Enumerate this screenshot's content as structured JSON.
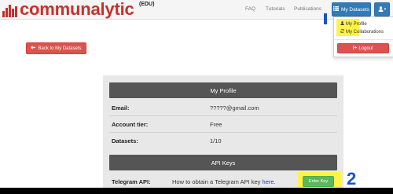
{
  "header": {
    "logo_text": "communalytic",
    "logo_edition": "(EDU)",
    "nav_links": [
      "FAQ",
      "Tutorials",
      "Publications"
    ],
    "datasets_button": "My Datasets",
    "user_menu_caret": "▾",
    "marker_1": "1"
  },
  "dropdown": {
    "items": [
      "My Profile",
      "My Collaborations"
    ],
    "logout": "Logout"
  },
  "back_button": "Back to My Datasets",
  "profile": {
    "title": "My Profile",
    "rows": [
      {
        "label": "Email:",
        "value": "?????@gmail.com"
      },
      {
        "label": "Account tier:",
        "value": "Free"
      },
      {
        "label": "Datasets:",
        "value": "1/10"
      }
    ]
  },
  "api_keys": {
    "title": "API Keys",
    "telegram_label": "Telegram API:",
    "telegram_text": "How to obtain a Telegram API key",
    "telegram_link": "here",
    "telegram_suffix": ".",
    "enter_key_button": "Enter Key",
    "marker_2": "2"
  },
  "colors": {
    "brand_red": "#c9302c",
    "primary_blue": "#337ab7",
    "danger_red": "#d9534f",
    "success_green": "#5cb85c",
    "highlight_yellow": "#fff34a",
    "annotation_blue": "#1a55c5"
  }
}
